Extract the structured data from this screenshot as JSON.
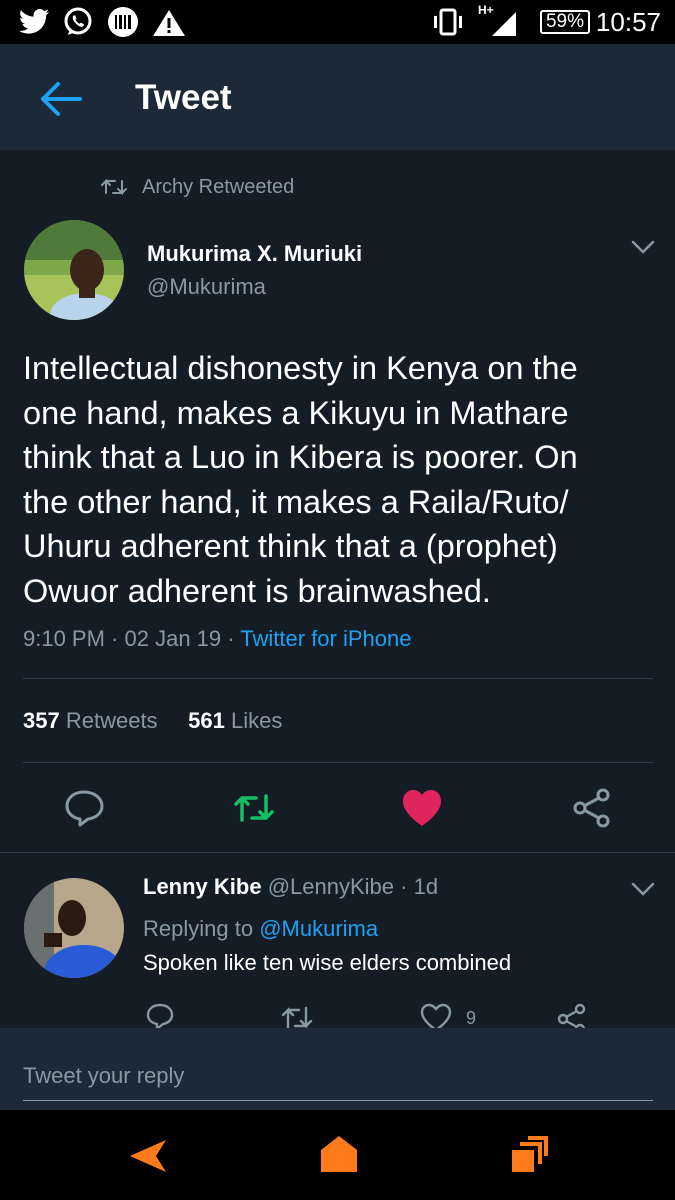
{
  "status_bar": {
    "network": "H+",
    "battery": "59%",
    "time": "10:57",
    "left_icons": [
      "twitter-icon",
      "whatsapp-icon",
      "barcode-app-icon",
      "warning-icon"
    ]
  },
  "header": {
    "title": "Tweet"
  },
  "retweet_note": "Archy Retweeted",
  "tweet": {
    "author_name": "Mukurima X. Muriuki",
    "author_handle": "@Mukurima",
    "text": "Intellectual dishonesty in Kenya on the\none hand, makes a Kikuyu in Mathare\nthink that  a Luo in Kibera is poorer. On\nthe other hand, it makes a  Raila/Ruto/\nUhuru adherent think that a (prophet)\nOwuor adherent is brainwashed.",
    "time": "9:10 PM",
    "date": "02 Jan 19",
    "source": "Twitter for iPhone",
    "retweets_count": "357",
    "retweets_label": "Retweets",
    "likes_count": "561",
    "likes_label": "Likes"
  },
  "reply": {
    "name": "Lenny Kibe",
    "handle": "@LennyKibe",
    "age": "1d",
    "replying_label": "Replying to",
    "replying_handle": "@Mukurima",
    "text": "Spoken like ten wise elders combined",
    "likes": "9"
  },
  "compose": {
    "placeholder": "Tweet your reply"
  },
  "colors": {
    "background": "#141d26",
    "header": "#1c2938",
    "accent": "#1da1f2",
    "retweet_green": "#17bf63",
    "like_red": "#e0245e",
    "muted": "#8899a6",
    "nav_orange": "#ff7a1a"
  }
}
